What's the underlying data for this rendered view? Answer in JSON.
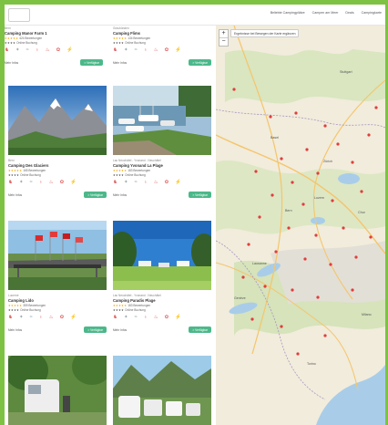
{
  "nav": {
    "items": [
      "Beliebte Campingplätze",
      "Campen am Meer",
      "Deals",
      "Campingkarte"
    ]
  },
  "cards": [
    {
      "region": "Bern",
      "name": "Camping Manor Farm 1",
      "rating_count": "424 Bewertungen",
      "rating_label": "Sehr gut",
      "booking_label": "Online Buchung",
      "more": "Mehr Infos",
      "book": "> Verfügbar"
    },
    {
      "region": "Graubünden",
      "name": "Camping Flims",
      "rating_count": "134 Bewertungen",
      "rating_label": "Sehr gut",
      "booking_label": "Online Buchung",
      "more": "Mehr Infos",
      "book": "> Verfügbar"
    },
    {
      "region": "Bern",
      "name": "Camping Des Glaciers",
      "rating_count": "165 Bewertungen",
      "rating_label": "Sehr gut",
      "booking_label": "Online Buchung",
      "more": "Mehr Infos",
      "book": "> Verfügbar"
    },
    {
      "region": "Lac Neuchâtel - Yvonand - Neuchâtel",
      "name": "Camping Yvonand La Plage",
      "rating_count": "183 Bewertungen",
      "rating_label": "Sehr gut",
      "booking_label": "Online Buchung",
      "more": "Mehr Infos",
      "book": "> Verfügbar"
    },
    {
      "region": "Lucerne",
      "name": "Camping Lido",
      "rating_count": "359 Bewertungen",
      "rating_label": "Sehr gut",
      "booking_label": "Online Buchung",
      "more": "Mehr Infos",
      "book": "> Verfügbar"
    },
    {
      "region": "Lac Neuchâtel - Yvonand - Neuchâtel",
      "name": "Camping Paradis Plage",
      "rating_count": "183 Bewertungen",
      "rating_label": "Sehr gut",
      "booking_label": "Online Buchung",
      "more": "Mehr Infos",
      "book": "> Verfügbar"
    }
  ],
  "map": {
    "toggle_label": "Ergebnisse bei Bewegen der Karte ergänzen",
    "zoom_in": "+",
    "zoom_out": "−",
    "cities": [
      "Stuttgart",
      "Zürich",
      "Basel",
      "Bern",
      "Lausanne",
      "Genève",
      "Luzern",
      "Chur",
      "Milano",
      "Torino"
    ]
  }
}
